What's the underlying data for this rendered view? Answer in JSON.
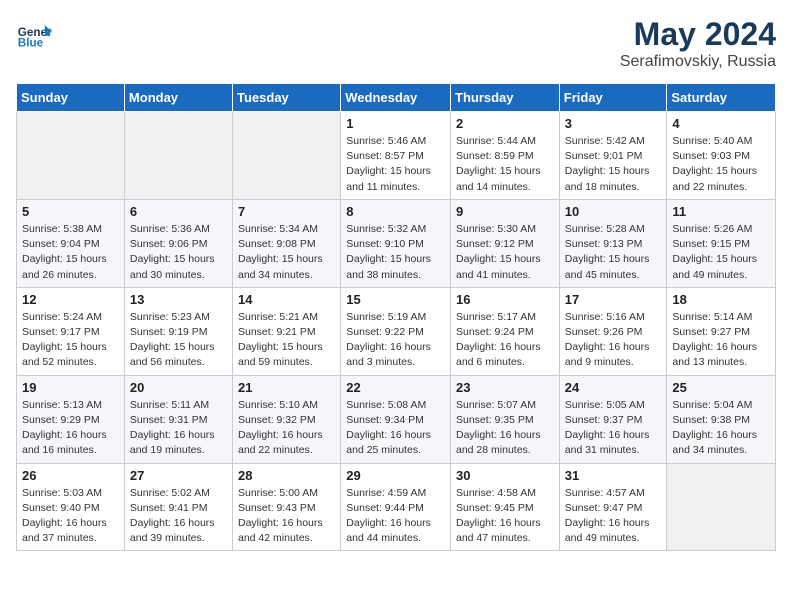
{
  "header": {
    "logo_line1": "General",
    "logo_line2": "Blue",
    "month_year": "May 2024",
    "location": "Serafimovskiy, Russia"
  },
  "weekdays": [
    "Sunday",
    "Monday",
    "Tuesday",
    "Wednesday",
    "Thursday",
    "Friday",
    "Saturday"
  ],
  "weeks": [
    [
      {
        "day": "",
        "info": ""
      },
      {
        "day": "",
        "info": ""
      },
      {
        "day": "",
        "info": ""
      },
      {
        "day": "1",
        "info": "Sunrise: 5:46 AM\nSunset: 8:57 PM\nDaylight: 15 hours\nand 11 minutes."
      },
      {
        "day": "2",
        "info": "Sunrise: 5:44 AM\nSunset: 8:59 PM\nDaylight: 15 hours\nand 14 minutes."
      },
      {
        "day": "3",
        "info": "Sunrise: 5:42 AM\nSunset: 9:01 PM\nDaylight: 15 hours\nand 18 minutes."
      },
      {
        "day": "4",
        "info": "Sunrise: 5:40 AM\nSunset: 9:03 PM\nDaylight: 15 hours\nand 22 minutes."
      }
    ],
    [
      {
        "day": "5",
        "info": "Sunrise: 5:38 AM\nSunset: 9:04 PM\nDaylight: 15 hours\nand 26 minutes."
      },
      {
        "day": "6",
        "info": "Sunrise: 5:36 AM\nSunset: 9:06 PM\nDaylight: 15 hours\nand 30 minutes."
      },
      {
        "day": "7",
        "info": "Sunrise: 5:34 AM\nSunset: 9:08 PM\nDaylight: 15 hours\nand 34 minutes."
      },
      {
        "day": "8",
        "info": "Sunrise: 5:32 AM\nSunset: 9:10 PM\nDaylight: 15 hours\nand 38 minutes."
      },
      {
        "day": "9",
        "info": "Sunrise: 5:30 AM\nSunset: 9:12 PM\nDaylight: 15 hours\nand 41 minutes."
      },
      {
        "day": "10",
        "info": "Sunrise: 5:28 AM\nSunset: 9:13 PM\nDaylight: 15 hours\nand 45 minutes."
      },
      {
        "day": "11",
        "info": "Sunrise: 5:26 AM\nSunset: 9:15 PM\nDaylight: 15 hours\nand 49 minutes."
      }
    ],
    [
      {
        "day": "12",
        "info": "Sunrise: 5:24 AM\nSunset: 9:17 PM\nDaylight: 15 hours\nand 52 minutes."
      },
      {
        "day": "13",
        "info": "Sunrise: 5:23 AM\nSunset: 9:19 PM\nDaylight: 15 hours\nand 56 minutes."
      },
      {
        "day": "14",
        "info": "Sunrise: 5:21 AM\nSunset: 9:21 PM\nDaylight: 15 hours\nand 59 minutes."
      },
      {
        "day": "15",
        "info": "Sunrise: 5:19 AM\nSunset: 9:22 PM\nDaylight: 16 hours\nand 3 minutes."
      },
      {
        "day": "16",
        "info": "Sunrise: 5:17 AM\nSunset: 9:24 PM\nDaylight: 16 hours\nand 6 minutes."
      },
      {
        "day": "17",
        "info": "Sunrise: 5:16 AM\nSunset: 9:26 PM\nDaylight: 16 hours\nand 9 minutes."
      },
      {
        "day": "18",
        "info": "Sunrise: 5:14 AM\nSunset: 9:27 PM\nDaylight: 16 hours\nand 13 minutes."
      }
    ],
    [
      {
        "day": "19",
        "info": "Sunrise: 5:13 AM\nSunset: 9:29 PM\nDaylight: 16 hours\nand 16 minutes."
      },
      {
        "day": "20",
        "info": "Sunrise: 5:11 AM\nSunset: 9:31 PM\nDaylight: 16 hours\nand 19 minutes."
      },
      {
        "day": "21",
        "info": "Sunrise: 5:10 AM\nSunset: 9:32 PM\nDaylight: 16 hours\nand 22 minutes."
      },
      {
        "day": "22",
        "info": "Sunrise: 5:08 AM\nSunset: 9:34 PM\nDaylight: 16 hours\nand 25 minutes."
      },
      {
        "day": "23",
        "info": "Sunrise: 5:07 AM\nSunset: 9:35 PM\nDaylight: 16 hours\nand 28 minutes."
      },
      {
        "day": "24",
        "info": "Sunrise: 5:05 AM\nSunset: 9:37 PM\nDaylight: 16 hours\nand 31 minutes."
      },
      {
        "day": "25",
        "info": "Sunrise: 5:04 AM\nSunset: 9:38 PM\nDaylight: 16 hours\nand 34 minutes."
      }
    ],
    [
      {
        "day": "26",
        "info": "Sunrise: 5:03 AM\nSunset: 9:40 PM\nDaylight: 16 hours\nand 37 minutes."
      },
      {
        "day": "27",
        "info": "Sunrise: 5:02 AM\nSunset: 9:41 PM\nDaylight: 16 hours\nand 39 minutes."
      },
      {
        "day": "28",
        "info": "Sunrise: 5:00 AM\nSunset: 9:43 PM\nDaylight: 16 hours\nand 42 minutes."
      },
      {
        "day": "29",
        "info": "Sunrise: 4:59 AM\nSunset: 9:44 PM\nDaylight: 16 hours\nand 44 minutes."
      },
      {
        "day": "30",
        "info": "Sunrise: 4:58 AM\nSunset: 9:45 PM\nDaylight: 16 hours\nand 47 minutes."
      },
      {
        "day": "31",
        "info": "Sunrise: 4:57 AM\nSunset: 9:47 PM\nDaylight: 16 hours\nand 49 minutes."
      },
      {
        "day": "",
        "info": ""
      }
    ]
  ]
}
